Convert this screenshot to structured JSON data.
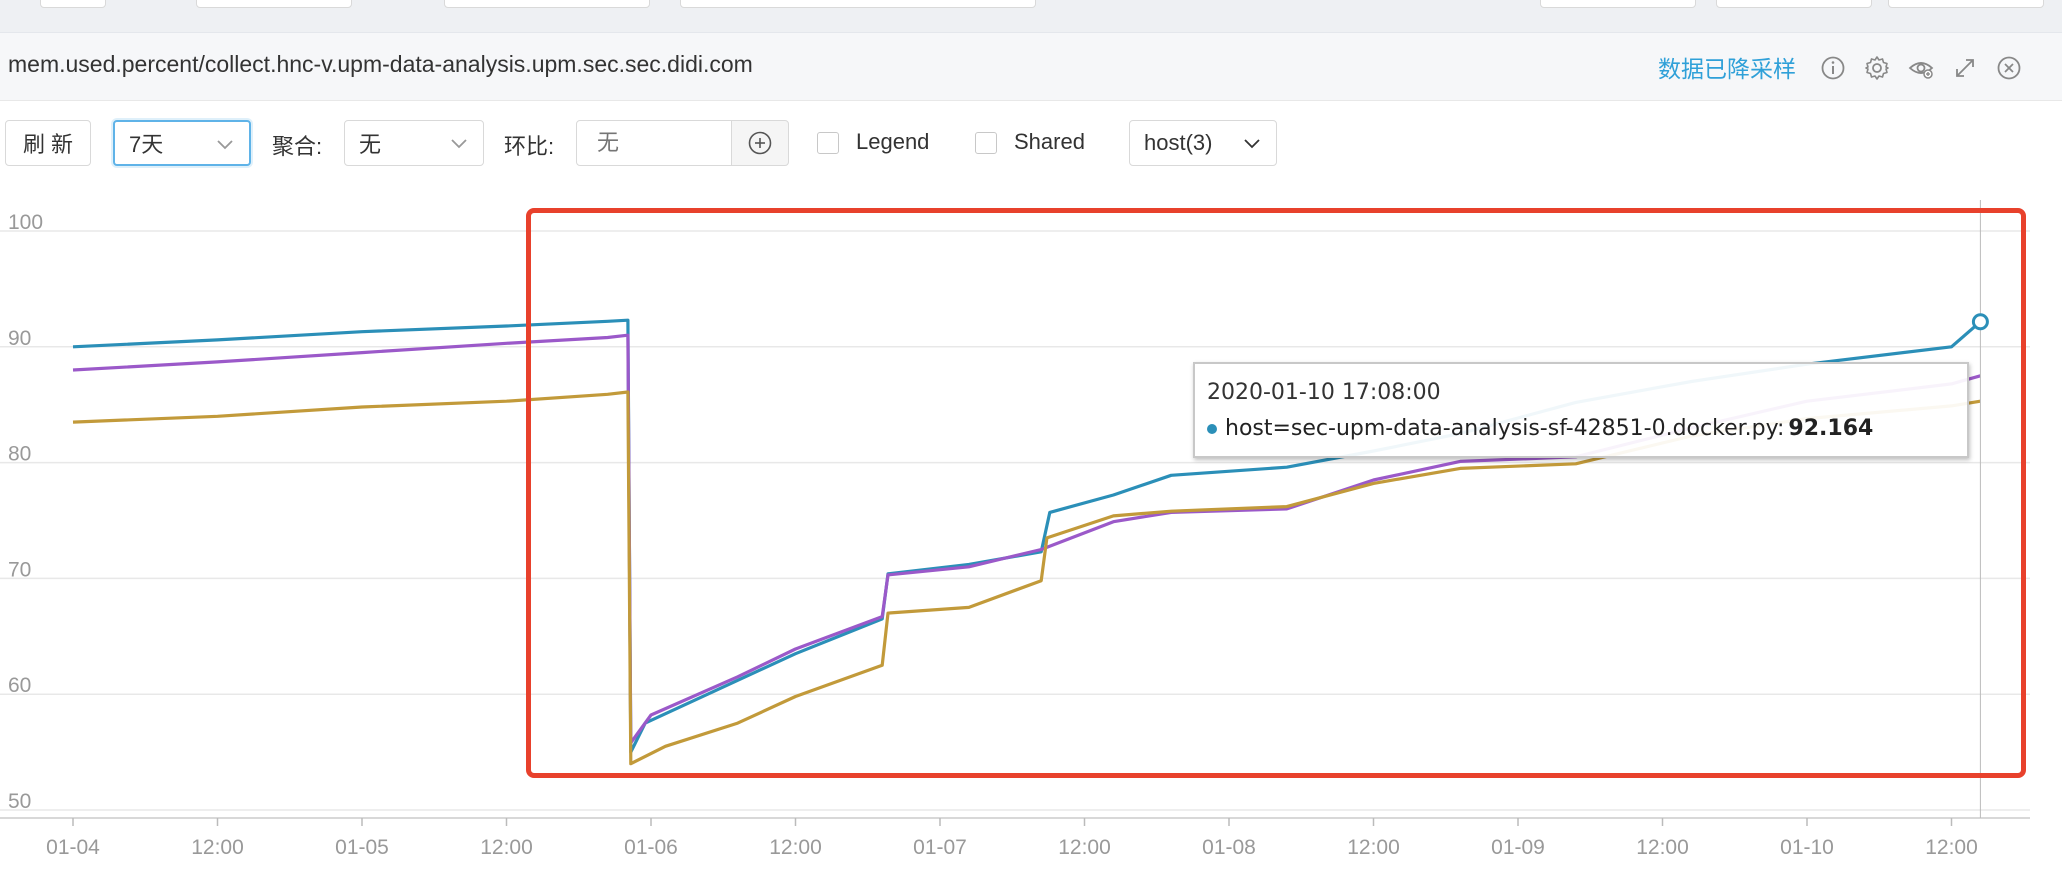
{
  "panel": {
    "title": "mem.used.percent/collect.hnc-v.upm-data-analysis.upm.sec.sec.didi.com",
    "downsample_status": "数据已降采样",
    "icons": [
      "info-icon",
      "gear-icon",
      "eye-icon",
      "expand-icon",
      "close-icon"
    ]
  },
  "toolbar": {
    "refresh_label": "刷 新",
    "range_value": "7天",
    "aggregate_label": "聚合:",
    "aggregate_value": "无",
    "compare_label": "环比:",
    "compare_placeholder": "无",
    "legend_label": "Legend",
    "shared_label": "Shared",
    "host_select": "host(3)"
  },
  "tooltip": {
    "time": "2020-01-10 17:08:00",
    "series": "host=sec-upm-data-analysis-sf-42851-0.docker.py:",
    "value": "92.164"
  },
  "colors": {
    "blue": "#2b8fb8",
    "purple": "#9b59c9",
    "gold": "#c29a3a",
    "highlight": "#e8412c",
    "accent": "#2fa0d8"
  },
  "chart_data": {
    "type": "line",
    "x_ticks": [
      "01-04",
      "12:00",
      "01-05",
      "12:00",
      "01-06",
      "12:00",
      "01-07",
      "12:00",
      "01-08",
      "12:00",
      "01-09",
      "12:00",
      "01-10",
      "12:00"
    ],
    "y_ticks": [
      "50",
      "60",
      "70",
      "80",
      "90",
      "100"
    ],
    "ylim": [
      50,
      100
    ],
    "grid": true,
    "series": [
      {
        "color": "#2b8fb8",
        "points": [
          [
            0,
            90.0
          ],
          [
            0.5,
            90.6
          ],
          [
            1.0,
            91.3
          ],
          [
            1.5,
            91.8
          ],
          [
            1.85,
            92.2
          ],
          [
            1.92,
            92.3
          ],
          [
            1.93,
            55.0
          ],
          [
            1.98,
            57.5
          ],
          [
            2.3,
            61.2
          ],
          [
            2.5,
            63.5
          ],
          [
            2.8,
            66.5
          ],
          [
            2.82,
            70.4
          ],
          [
            3.1,
            71.2
          ],
          [
            3.35,
            72.3
          ],
          [
            3.38,
            75.7
          ],
          [
            3.6,
            77.2
          ],
          [
            3.8,
            78.9
          ],
          [
            4.2,
            79.6
          ],
          [
            4.5,
            81.0
          ],
          [
            4.8,
            82.5
          ],
          [
            5.2,
            85.2
          ],
          [
            5.6,
            87.0
          ],
          [
            6.0,
            88.5
          ],
          [
            6.5,
            90.0
          ],
          [
            6.6,
            92.164
          ]
        ]
      },
      {
        "color": "#9b59c9",
        "points": [
          [
            0,
            88.0
          ],
          [
            0.5,
            88.7
          ],
          [
            1.0,
            89.5
          ],
          [
            1.5,
            90.3
          ],
          [
            1.85,
            90.8
          ],
          [
            1.92,
            91.0
          ],
          [
            1.93,
            55.8
          ],
          [
            2.0,
            58.2
          ],
          [
            2.3,
            61.5
          ],
          [
            2.5,
            63.9
          ],
          [
            2.8,
            66.7
          ],
          [
            2.82,
            70.3
          ],
          [
            3.1,
            71.0
          ],
          [
            3.35,
            72.5
          ],
          [
            3.6,
            74.9
          ],
          [
            3.8,
            75.7
          ],
          [
            4.2,
            76.0
          ],
          [
            4.5,
            78.5
          ],
          [
            4.8,
            80.1
          ],
          [
            5.2,
            80.5
          ],
          [
            5.6,
            83.0
          ],
          [
            6.0,
            85.3
          ],
          [
            6.5,
            86.8
          ],
          [
            6.6,
            87.5
          ]
        ]
      },
      {
        "color": "#c29a3a",
        "points": [
          [
            0,
            83.5
          ],
          [
            0.5,
            84.0
          ],
          [
            1.0,
            84.8
          ],
          [
            1.5,
            85.3
          ],
          [
            1.85,
            85.9
          ],
          [
            1.92,
            86.1
          ],
          [
            1.93,
            54.0
          ],
          [
            2.05,
            55.5
          ],
          [
            2.3,
            57.5
          ],
          [
            2.5,
            59.8
          ],
          [
            2.8,
            62.5
          ],
          [
            2.82,
            67.0
          ],
          [
            3.1,
            67.5
          ],
          [
            3.35,
            69.8
          ],
          [
            3.37,
            73.5
          ],
          [
            3.6,
            75.4
          ],
          [
            3.8,
            75.8
          ],
          [
            4.2,
            76.2
          ],
          [
            4.5,
            78.2
          ],
          [
            4.8,
            79.5
          ],
          [
            5.2,
            79.9
          ],
          [
            5.6,
            82.3
          ],
          [
            6.0,
            83.8
          ],
          [
            6.5,
            84.9
          ],
          [
            6.6,
            85.3
          ]
        ]
      }
    ]
  }
}
